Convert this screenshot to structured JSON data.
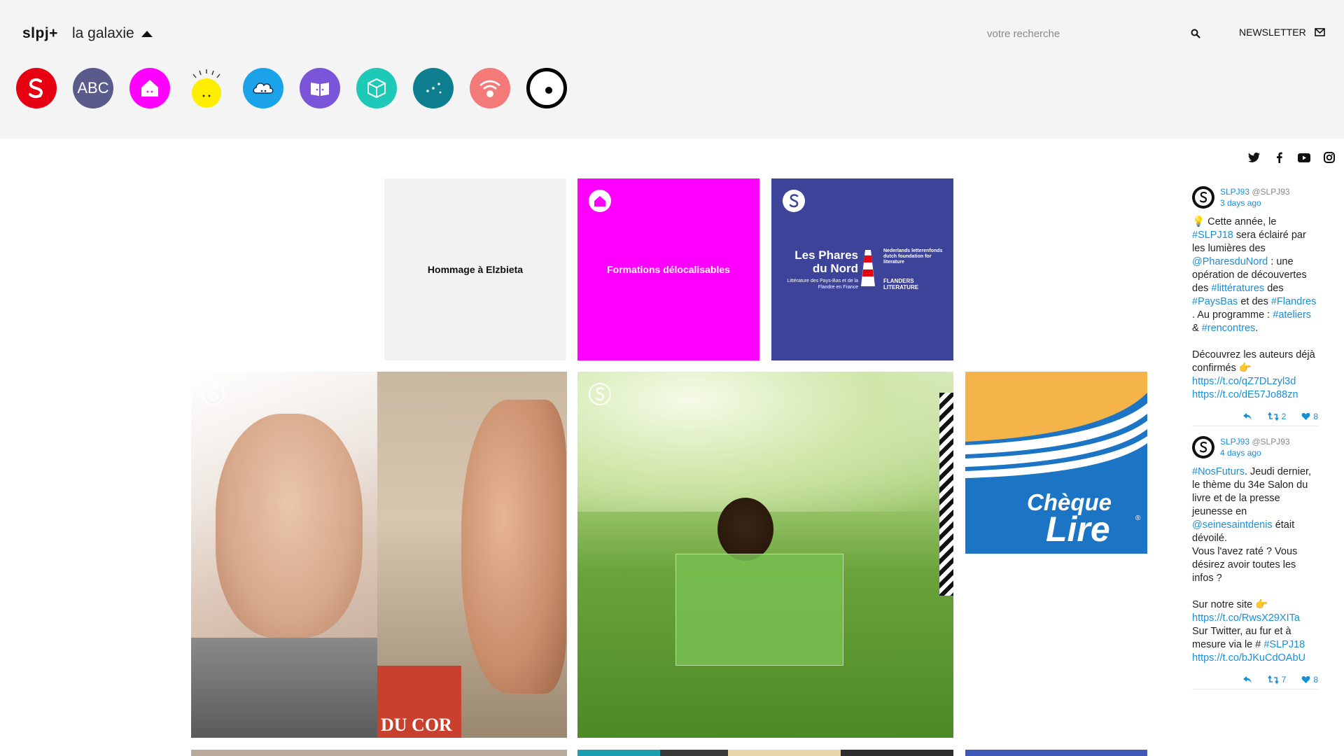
{
  "header": {
    "brand": "slpj+",
    "galaxie_label": "la galaxie",
    "search_placeholder": "votre recherche",
    "newsletter_label": "NEWSLETTER"
  },
  "galaxy_icons": [
    {
      "name": "slpj",
      "color": "#e60012"
    },
    {
      "name": "abc",
      "color": "#5a5a8c",
      "text": "ABC"
    },
    {
      "name": "maison",
      "color": "#ff00ff"
    },
    {
      "name": "soleil",
      "color": "#ffee00"
    },
    {
      "name": "nuage",
      "color": "#1aa3e8"
    },
    {
      "name": "livre",
      "color": "#7a55d9"
    },
    {
      "name": "cube",
      "color": "#1ec9b7"
    },
    {
      "name": "etoiles",
      "color": "#0e7f8e"
    },
    {
      "name": "wifi",
      "color": "#f47a7a"
    },
    {
      "name": "cercle",
      "color": "#000000"
    }
  ],
  "tiles": {
    "hommage": "Hommage à Elzbieta",
    "formations": "Formations délocalisables",
    "phares_title": "Les Phares du Nord",
    "phares_sub": "Littérature des Pays-Bas et de la Flandre en France",
    "phares_nl": "Nederlands letterenfonds dutch foundation for literature",
    "phares_fl": "FLANDERS LITERATURE",
    "cheque_line1": "Chèque",
    "cheque_line2": "Lire",
    "cheque_reg": "®",
    "du_cor": "DU COR"
  },
  "tweets": [
    {
      "name": "SLPJ93",
      "handle": "@SLPJ93",
      "time": "3 days ago",
      "retweets": "2",
      "likes": "8"
    },
    {
      "name": "SLPJ93",
      "handle": "@SLPJ93",
      "time": "4 days ago",
      "retweets": "7",
      "likes": "8"
    }
  ],
  "tweet1": {
    "bulb": "💡",
    "t1": " Cette année, le ",
    "h1": "#SLPJ18",
    "t2": " sera éclairé par les lumières des ",
    "h2": "@PharesduNord",
    "t3": " : une opération de découvertes des ",
    "h3": "#littératures",
    "t4": " des ",
    "h4": "#PaysBas",
    "t5": " et des ",
    "h5": "#Flandres",
    "t6": " . Au programme : ",
    "h6": "#ateliers",
    "t7": " & ",
    "h7": "#rencontres",
    "t8": ".",
    "t9": "Découvrez les auteurs déjà confirmés ",
    "hand": "👉",
    "l1": "https://t.co/qZ7DLzyl3d",
    "l2": "https://t.co/dE57Jo88zn"
  },
  "tweet2": {
    "h1": "#NosFuturs",
    "t1": ". Jeudi dernier, le thème du 34e Salon du livre et de la presse jeunesse en ",
    "h2": "@seinesaintdenis",
    "t2": " était dévoilé.",
    "t3": "Vous l'avez raté ? Vous désirez avoir toutes les infos ?",
    "t4": "Sur notre site ",
    "hand": "👉",
    "l1": "https://t.co/RwsX29XITa",
    "t5": "Sur Twitter, au fur et à mesure via le # ",
    "h3": "#SLPJ18",
    "l2": "https://t.co/bJKuCdOAbU"
  }
}
